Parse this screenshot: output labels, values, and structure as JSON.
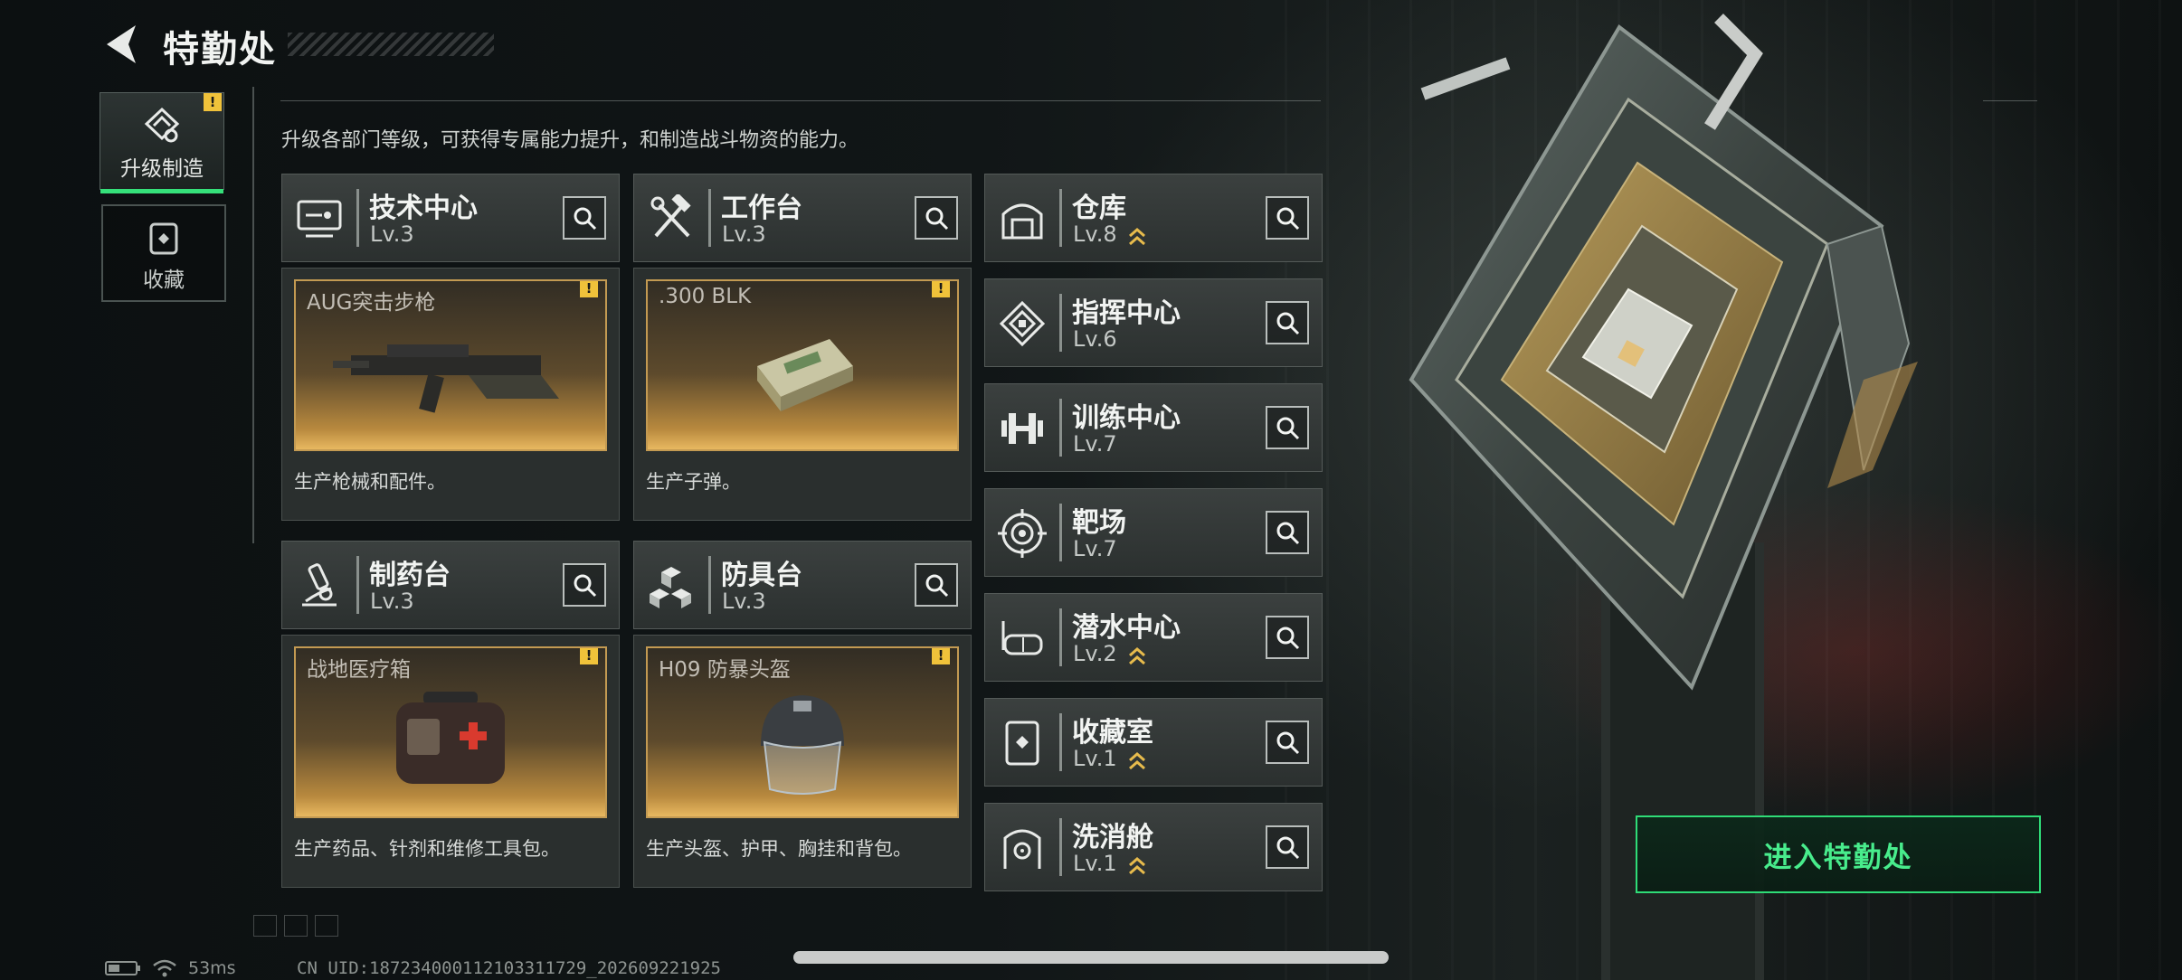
{
  "header": {
    "title": "特勤处"
  },
  "nav": [
    {
      "label": "升级制造",
      "active": true,
      "badge": "!"
    },
    {
      "label": "收藏",
      "active": false
    }
  ],
  "subtitle": "升级各部门等级，可获得专属能力提升，和制造战斗物资的能力。",
  "cards": [
    {
      "name": "技术中心",
      "level": "Lv.3",
      "icon": "tech-center-icon",
      "product": "AUG突击步枪",
      "product_badge": "!",
      "description": "生产枪械和配件。"
    },
    {
      "name": "工作台",
      "level": "Lv.3",
      "icon": "hammer-wrench-icon",
      "product": ".300 BLK",
      "product_badge": "!",
      "description": "生产子弹。"
    },
    {
      "name": "制药台",
      "level": "Lv.3",
      "icon": "microscope-icon",
      "product": "战地医疗箱",
      "product_badge": "!",
      "description": "生产药品、针剂和维修工具包。"
    },
    {
      "name": "防具台",
      "level": "Lv.3",
      "icon": "cubes-icon",
      "product": "H09 防暴头盔",
      "product_badge": "!",
      "description": "生产头盔、护甲、胸挂和背包。"
    }
  ],
  "departments": [
    {
      "name": "仓库",
      "level": "Lv.8",
      "icon": "warehouse-icon",
      "upgradable": true
    },
    {
      "name": "指挥中心",
      "level": "Lv.6",
      "icon": "command-center-icon",
      "upgradable": false
    },
    {
      "name": "训练中心",
      "level": "Lv.7",
      "icon": "dumbbell-icon",
      "upgradable": false
    },
    {
      "name": "靶场",
      "level": "Lv.7",
      "icon": "target-icon",
      "upgradable": false
    },
    {
      "name": "潜水中心",
      "level": "Lv.2",
      "icon": "diving-mask-icon",
      "upgradable": true
    },
    {
      "name": "收藏室",
      "level": "Lv.1",
      "icon": "collection-room-icon",
      "upgradable": true
    },
    {
      "name": "洗消舱",
      "level": "Lv.1",
      "icon": "decon-pod-icon",
      "upgradable": true
    }
  ],
  "enter_button": "进入特勤处",
  "footer": {
    "ping": "53ms",
    "uid": "CN UID:18723400011210331172​9_202609221925"
  },
  "colors": {
    "accent_green": "#2fdc77",
    "badge_yellow": "#f0c23a",
    "gold": "#e8b860"
  }
}
